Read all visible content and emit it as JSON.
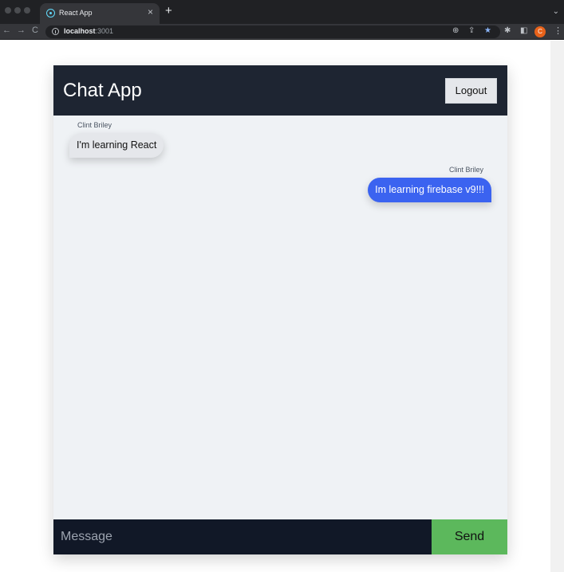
{
  "browser": {
    "tab_title": "React App",
    "tab_close": "×",
    "new_tab": "+",
    "tab_list": "⌄",
    "nav_back": "←",
    "nav_forward": "→",
    "nav_reload": "C",
    "url_host": "localhost",
    "url_port": ":3001",
    "zoom_icon": "⊕",
    "share_icon": "⇪",
    "bookmark_icon": "★",
    "bookmark_color": "#8ab4f8",
    "extensions_icon": "✱",
    "sidepanel_icon": "◧",
    "profile_initial": "C",
    "menu_icon": "⋮"
  },
  "app": {
    "title": "Chat App",
    "logout_label": "Logout",
    "messages": [
      {
        "author": "Clint Briley",
        "text": "I'm learning React",
        "side": "left"
      },
      {
        "author": "Clint Briley",
        "text": "Im learning firebase v9!!!",
        "side": "right"
      }
    ],
    "composer": {
      "placeholder": "Message",
      "send_label": "Send"
    },
    "colors": {
      "navbar": "#1e2532",
      "sent_bubble": "#3b63f0",
      "received_bubble": "#e5e7eb",
      "send_button": "#5cb85c"
    }
  }
}
